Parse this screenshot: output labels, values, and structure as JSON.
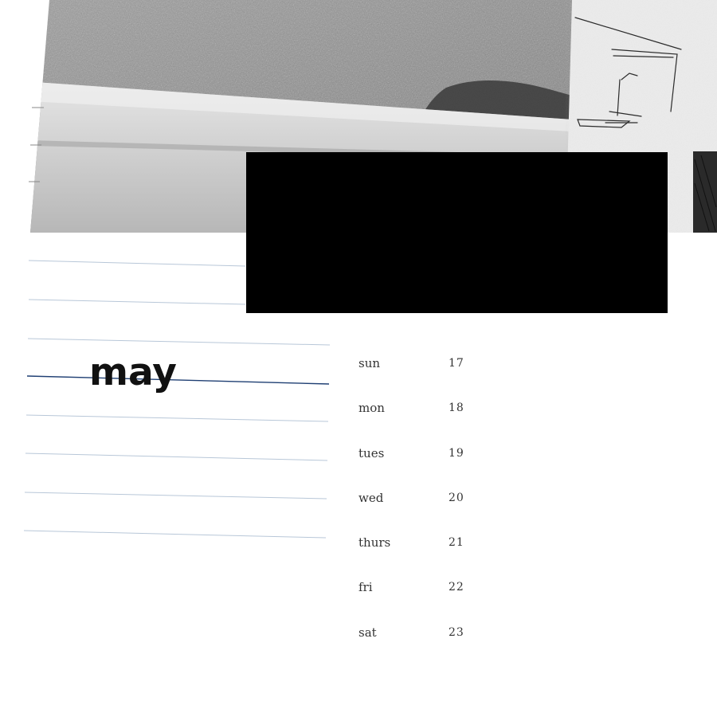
{
  "month": "may",
  "week": [
    {
      "day": "sun",
      "date": "17"
    },
    {
      "day": "mon",
      "date": "18"
    },
    {
      "day": "tues",
      "date": "19"
    },
    {
      "day": "wed",
      "date": "20"
    },
    {
      "day": "thurs",
      "date": "21"
    },
    {
      "day": "fri",
      "date": "22"
    },
    {
      "day": "sat",
      "date": "23"
    }
  ],
  "colors": {
    "rule_line": "#b8c7d8",
    "accent_line": "#1f3f73",
    "block": "#000000"
  }
}
